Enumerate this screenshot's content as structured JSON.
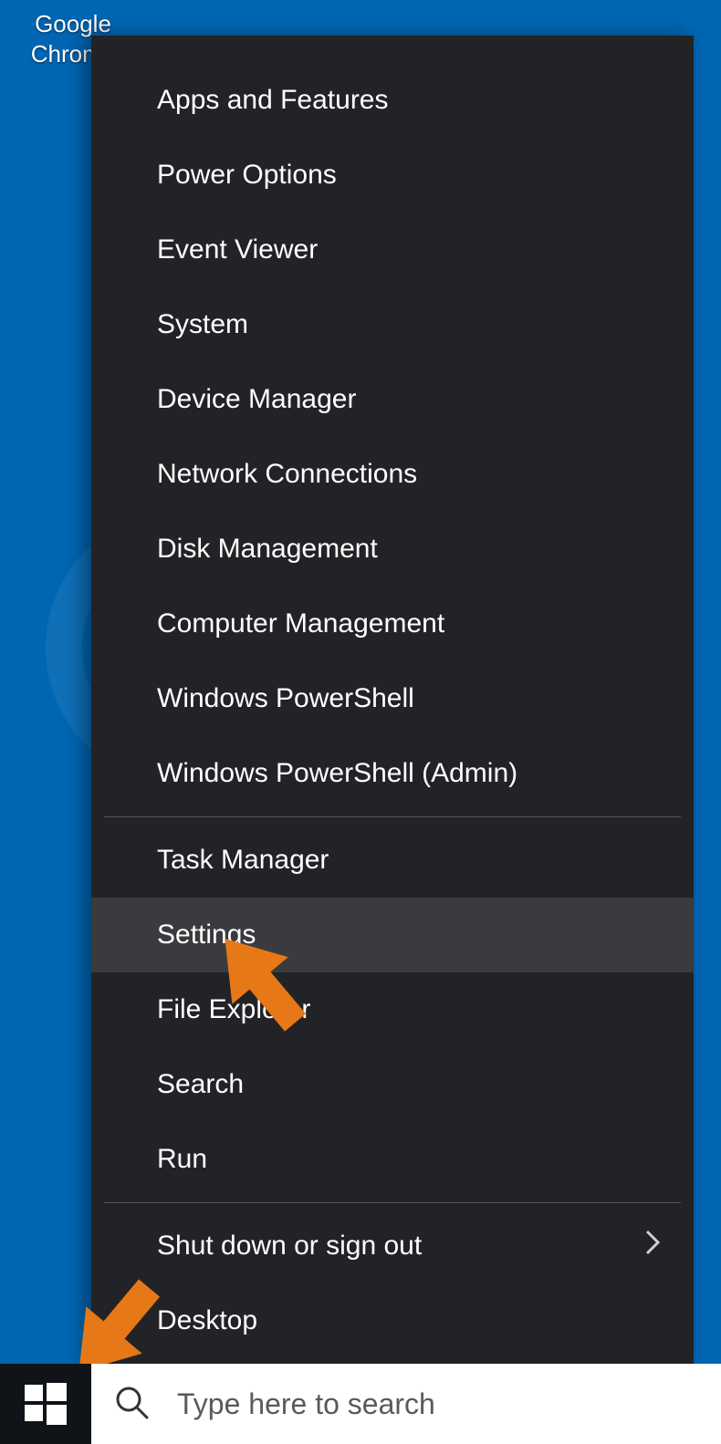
{
  "desktop_icon": {
    "label": "Google Chrome"
  },
  "menu": {
    "items": [
      {
        "label": "Apps and Features"
      },
      {
        "label": "Power Options"
      },
      {
        "label": "Event Viewer"
      },
      {
        "label": "System"
      },
      {
        "label": "Device Manager"
      },
      {
        "label": "Network Connections"
      },
      {
        "label": "Disk Management"
      },
      {
        "label": "Computer Management"
      },
      {
        "label": "Windows PowerShell"
      },
      {
        "label": "Windows PowerShell (Admin)"
      }
    ],
    "items2": [
      {
        "label": "Task Manager"
      },
      {
        "label": "Settings"
      },
      {
        "label": "File Explorer"
      },
      {
        "label": "Search"
      },
      {
        "label": "Run"
      }
    ],
    "items3": [
      {
        "label": "Shut down or sign out",
        "submenu": true
      },
      {
        "label": "Desktop"
      }
    ],
    "highlighted_index": 1
  },
  "taskbar": {
    "search_placeholder": "Type here to search"
  },
  "colors": {
    "desktop_bg": "#0066b3",
    "menu_bg": "#222326",
    "menu_hover": "#3a3b3e",
    "arrow": "#e77817"
  }
}
